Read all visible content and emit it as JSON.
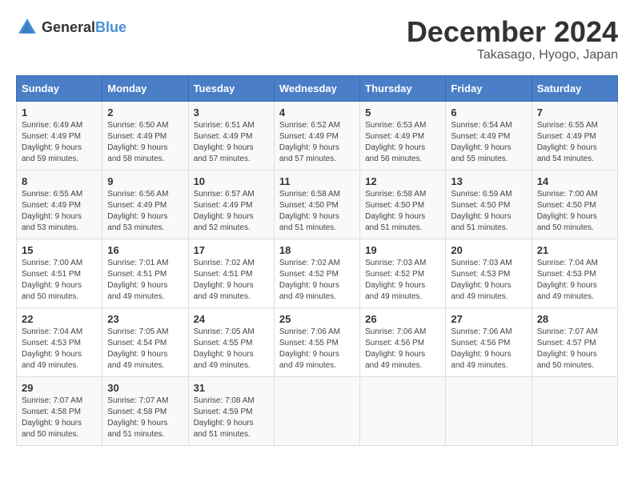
{
  "logo": {
    "text_general": "General",
    "text_blue": "Blue"
  },
  "header": {
    "month_title": "December 2024",
    "location": "Takasago, Hyogo, Japan"
  },
  "days_of_week": [
    "Sunday",
    "Monday",
    "Tuesday",
    "Wednesday",
    "Thursday",
    "Friday",
    "Saturday"
  ],
  "weeks": [
    [
      {
        "day": "1",
        "sunrise": "Sunrise: 6:49 AM",
        "sunset": "Sunset: 4:49 PM",
        "daylight": "Daylight: 9 hours and 59 minutes."
      },
      {
        "day": "2",
        "sunrise": "Sunrise: 6:50 AM",
        "sunset": "Sunset: 4:49 PM",
        "daylight": "Daylight: 9 hours and 58 minutes."
      },
      {
        "day": "3",
        "sunrise": "Sunrise: 6:51 AM",
        "sunset": "Sunset: 4:49 PM",
        "daylight": "Daylight: 9 hours and 57 minutes."
      },
      {
        "day": "4",
        "sunrise": "Sunrise: 6:52 AM",
        "sunset": "Sunset: 4:49 PM",
        "daylight": "Daylight: 9 hours and 57 minutes."
      },
      {
        "day": "5",
        "sunrise": "Sunrise: 6:53 AM",
        "sunset": "Sunset: 4:49 PM",
        "daylight": "Daylight: 9 hours and 56 minutes."
      },
      {
        "day": "6",
        "sunrise": "Sunrise: 6:54 AM",
        "sunset": "Sunset: 4:49 PM",
        "daylight": "Daylight: 9 hours and 55 minutes."
      },
      {
        "day": "7",
        "sunrise": "Sunrise: 6:55 AM",
        "sunset": "Sunset: 4:49 PM",
        "daylight": "Daylight: 9 hours and 54 minutes."
      }
    ],
    [
      {
        "day": "8",
        "sunrise": "Sunrise: 6:55 AM",
        "sunset": "Sunset: 4:49 PM",
        "daylight": "Daylight: 9 hours and 53 minutes."
      },
      {
        "day": "9",
        "sunrise": "Sunrise: 6:56 AM",
        "sunset": "Sunset: 4:49 PM",
        "daylight": "Daylight: 9 hours and 53 minutes."
      },
      {
        "day": "10",
        "sunrise": "Sunrise: 6:57 AM",
        "sunset": "Sunset: 4:49 PM",
        "daylight": "Daylight: 9 hours and 52 minutes."
      },
      {
        "day": "11",
        "sunrise": "Sunrise: 6:58 AM",
        "sunset": "Sunset: 4:50 PM",
        "daylight": "Daylight: 9 hours and 51 minutes."
      },
      {
        "day": "12",
        "sunrise": "Sunrise: 6:58 AM",
        "sunset": "Sunset: 4:50 PM",
        "daylight": "Daylight: 9 hours and 51 minutes."
      },
      {
        "day": "13",
        "sunrise": "Sunrise: 6:59 AM",
        "sunset": "Sunset: 4:50 PM",
        "daylight": "Daylight: 9 hours and 51 minutes."
      },
      {
        "day": "14",
        "sunrise": "Sunrise: 7:00 AM",
        "sunset": "Sunset: 4:50 PM",
        "daylight": "Daylight: 9 hours and 50 minutes."
      }
    ],
    [
      {
        "day": "15",
        "sunrise": "Sunrise: 7:00 AM",
        "sunset": "Sunset: 4:51 PM",
        "daylight": "Daylight: 9 hours and 50 minutes."
      },
      {
        "day": "16",
        "sunrise": "Sunrise: 7:01 AM",
        "sunset": "Sunset: 4:51 PM",
        "daylight": "Daylight: 9 hours and 49 minutes."
      },
      {
        "day": "17",
        "sunrise": "Sunrise: 7:02 AM",
        "sunset": "Sunset: 4:51 PM",
        "daylight": "Daylight: 9 hours and 49 minutes."
      },
      {
        "day": "18",
        "sunrise": "Sunrise: 7:02 AM",
        "sunset": "Sunset: 4:52 PM",
        "daylight": "Daylight: 9 hours and 49 minutes."
      },
      {
        "day": "19",
        "sunrise": "Sunrise: 7:03 AM",
        "sunset": "Sunset: 4:52 PM",
        "daylight": "Daylight: 9 hours and 49 minutes."
      },
      {
        "day": "20",
        "sunrise": "Sunrise: 7:03 AM",
        "sunset": "Sunset: 4:53 PM",
        "daylight": "Daylight: 9 hours and 49 minutes."
      },
      {
        "day": "21",
        "sunrise": "Sunrise: 7:04 AM",
        "sunset": "Sunset: 4:53 PM",
        "daylight": "Daylight: 9 hours and 49 minutes."
      }
    ],
    [
      {
        "day": "22",
        "sunrise": "Sunrise: 7:04 AM",
        "sunset": "Sunset: 4:53 PM",
        "daylight": "Daylight: 9 hours and 49 minutes."
      },
      {
        "day": "23",
        "sunrise": "Sunrise: 7:05 AM",
        "sunset": "Sunset: 4:54 PM",
        "daylight": "Daylight: 9 hours and 49 minutes."
      },
      {
        "day": "24",
        "sunrise": "Sunrise: 7:05 AM",
        "sunset": "Sunset: 4:55 PM",
        "daylight": "Daylight: 9 hours and 49 minutes."
      },
      {
        "day": "25",
        "sunrise": "Sunrise: 7:06 AM",
        "sunset": "Sunset: 4:55 PM",
        "daylight": "Daylight: 9 hours and 49 minutes."
      },
      {
        "day": "26",
        "sunrise": "Sunrise: 7:06 AM",
        "sunset": "Sunset: 4:56 PM",
        "daylight": "Daylight: 9 hours and 49 minutes."
      },
      {
        "day": "27",
        "sunrise": "Sunrise: 7:06 AM",
        "sunset": "Sunset: 4:56 PM",
        "daylight": "Daylight: 9 hours and 49 minutes."
      },
      {
        "day": "28",
        "sunrise": "Sunrise: 7:07 AM",
        "sunset": "Sunset: 4:57 PM",
        "daylight": "Daylight: 9 hours and 50 minutes."
      }
    ],
    [
      {
        "day": "29",
        "sunrise": "Sunrise: 7:07 AM",
        "sunset": "Sunset: 4:58 PM",
        "daylight": "Daylight: 9 hours and 50 minutes."
      },
      {
        "day": "30",
        "sunrise": "Sunrise: 7:07 AM",
        "sunset": "Sunset: 4:58 PM",
        "daylight": "Daylight: 9 hours and 51 minutes."
      },
      {
        "day": "31",
        "sunrise": "Sunrise: 7:08 AM",
        "sunset": "Sunset: 4:59 PM",
        "daylight": "Daylight: 9 hours and 51 minutes."
      },
      {
        "day": "",
        "sunrise": "",
        "sunset": "",
        "daylight": ""
      },
      {
        "day": "",
        "sunrise": "",
        "sunset": "",
        "daylight": ""
      },
      {
        "day": "",
        "sunrise": "",
        "sunset": "",
        "daylight": ""
      },
      {
        "day": "",
        "sunrise": "",
        "sunset": "",
        "daylight": ""
      }
    ]
  ]
}
